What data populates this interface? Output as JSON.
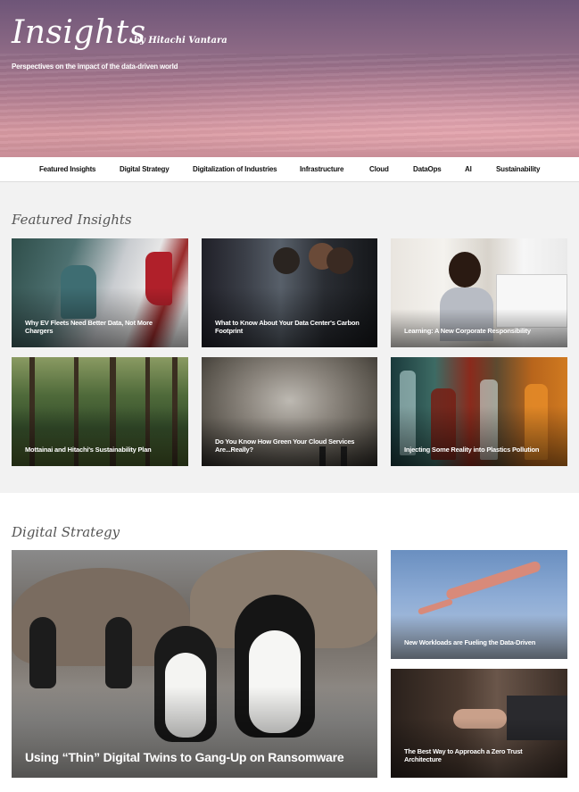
{
  "hero": {
    "title": "Insights",
    "by": "by Hitachi Vantara",
    "subtitle": "Perspectives on the impact of the data-driven world"
  },
  "nav": {
    "items": [
      "Featured Insights",
      "Digital Strategy",
      "Digitalization of Industries",
      "Infrastructure",
      "Cloud",
      "DataOps",
      "AI",
      "Sustainability"
    ]
  },
  "featured": {
    "title": "Featured Insights",
    "cards": [
      "Why EV Fleets Need Better Data, Not More Chargers",
      "What to Know About Your Data Center's Carbon Footprint",
      "Learning: A New Corporate Responsibility",
      "Mottainai and Hitachi's Sustainability Plan",
      "Do You Know How Green Your Cloud Services Are...Really?",
      "Injecting Some Reality into Plastics Pollution"
    ]
  },
  "digital_strategy": {
    "title": "Digital Strategy",
    "main_card": "Using “Thin” Digital Twins to Gang-Up on Ransomware",
    "side_cards": [
      "New Workloads are Fueling the Data-Driven",
      "The Best Way to Approach a Zero Trust Architecture"
    ]
  }
}
